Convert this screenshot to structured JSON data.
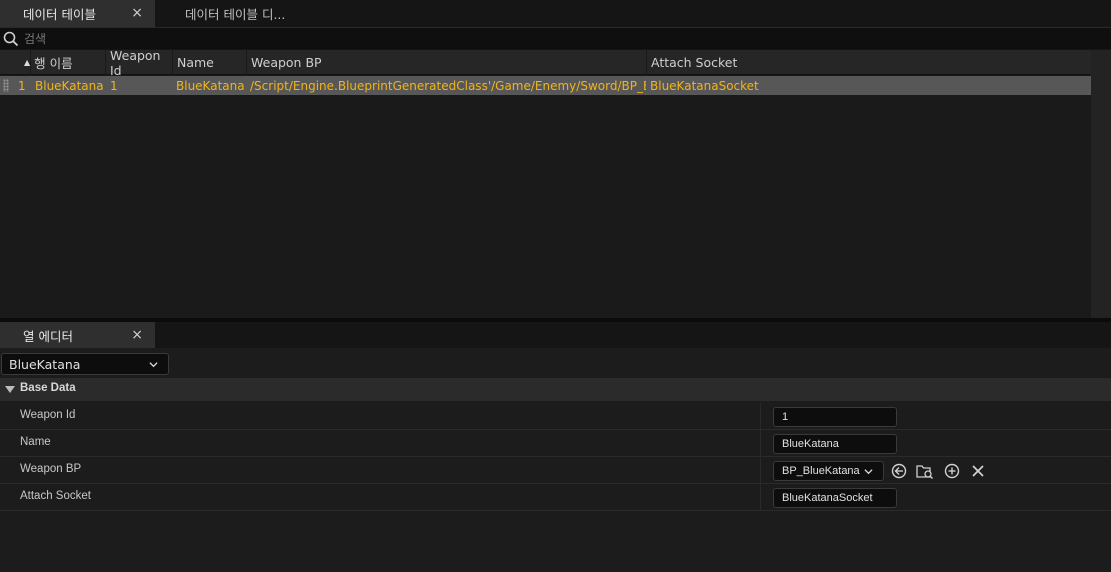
{
  "tabs": [
    {
      "label": "데이터 테이블",
      "close": "×"
    },
    {
      "label": "데이터 테이블 디..."
    }
  ],
  "search": {
    "placeholder": "검색"
  },
  "table": {
    "columns": [
      "행 이름",
      "Weapon Id",
      "Name",
      "Weapon BP",
      "Attach Socket"
    ],
    "rows": [
      {
        "index": "1",
        "row_name": "BlueKatana",
        "weapon_id": "1",
        "name": "BlueKatana",
        "weapon_bp": "/Script/Engine.BlueprintGeneratedClass'/Game/Enemy/Sword/BP_BlueK",
        "attach_socket": "BlueKatanaSocket"
      }
    ]
  },
  "row_editor": {
    "tab_label": "열 에디터",
    "close": "×",
    "selected_row": "BlueKatana",
    "category": "Base Data",
    "properties": [
      {
        "name": "Weapon Id",
        "value": "1"
      },
      {
        "name": "Name",
        "value": "BlueKatana"
      },
      {
        "name": "Weapon BP",
        "value": "BP_BlueKatana"
      },
      {
        "name": "Attach Socket",
        "value": "BlueKatanaSocket"
      }
    ]
  },
  "icons": {
    "search": "search-icon",
    "browse": "use-selected-icon",
    "find": "browse-folder-icon",
    "add": "add-icon",
    "clear": "clear-icon"
  },
  "colors": {
    "row_text": "#f2b418",
    "selected_row_bg": "#575757",
    "active_tab_bg": "#2f2f2f"
  }
}
